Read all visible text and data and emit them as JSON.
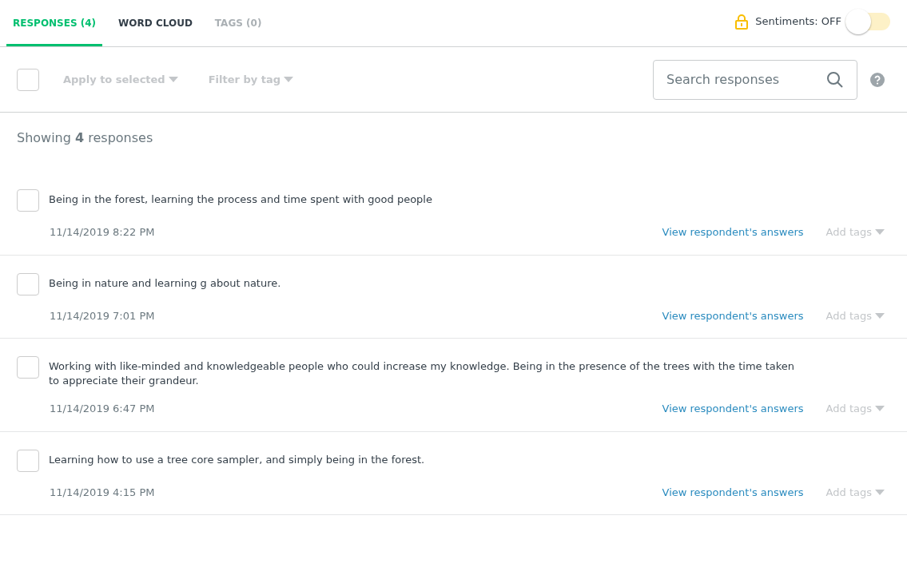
{
  "tabs": [
    {
      "label": "RESPONSES (4)",
      "selected": true,
      "disabled": false
    },
    {
      "label": "WORD CLOUD",
      "selected": false,
      "disabled": false
    },
    {
      "label": "TAGS (0)",
      "selected": false,
      "disabled": true
    }
  ],
  "sentiments": {
    "label": "Sentiments: OFF",
    "on": false
  },
  "toolbar": {
    "select_all_checked": false,
    "apply": {
      "label": "Apply to selected",
      "disabled": true
    },
    "filter": {
      "label": "Filter by tag",
      "disabled": true
    },
    "search": {
      "placeholder": "Search responses"
    }
  },
  "summary": "Showing **4** responses",
  "responses": [
    {
      "text": "Being in the forest, learning the process and time spent with good people",
      "date": "11/14/2019 8:22 PM",
      "checked": false,
      "link": "View respondent's answers",
      "tags": "Add tags"
    },
    {
      "text": "Being in nature and learning g about nature.",
      "date": "11/14/2019 7:01 PM",
      "checked": false,
      "link": "View respondent's answers",
      "tags": "Add tags"
    },
    {
      "text": "Working with like-minded and knowledgeable people who could increase my knowledge. Being in the presence of the trees with the time taken to appreciate their grandeur.",
      "date": "11/14/2019 6:47 PM",
      "checked": false,
      "link": "View respondent's answers",
      "tags": "Add tags"
    },
    {
      "text": "Learning how to use a tree core sampler, and simply being in the forest.",
      "date": "11/14/2019 4:15 PM",
      "checked": false,
      "link": "View respondent's answers",
      "tags": "Add tags"
    }
  ]
}
